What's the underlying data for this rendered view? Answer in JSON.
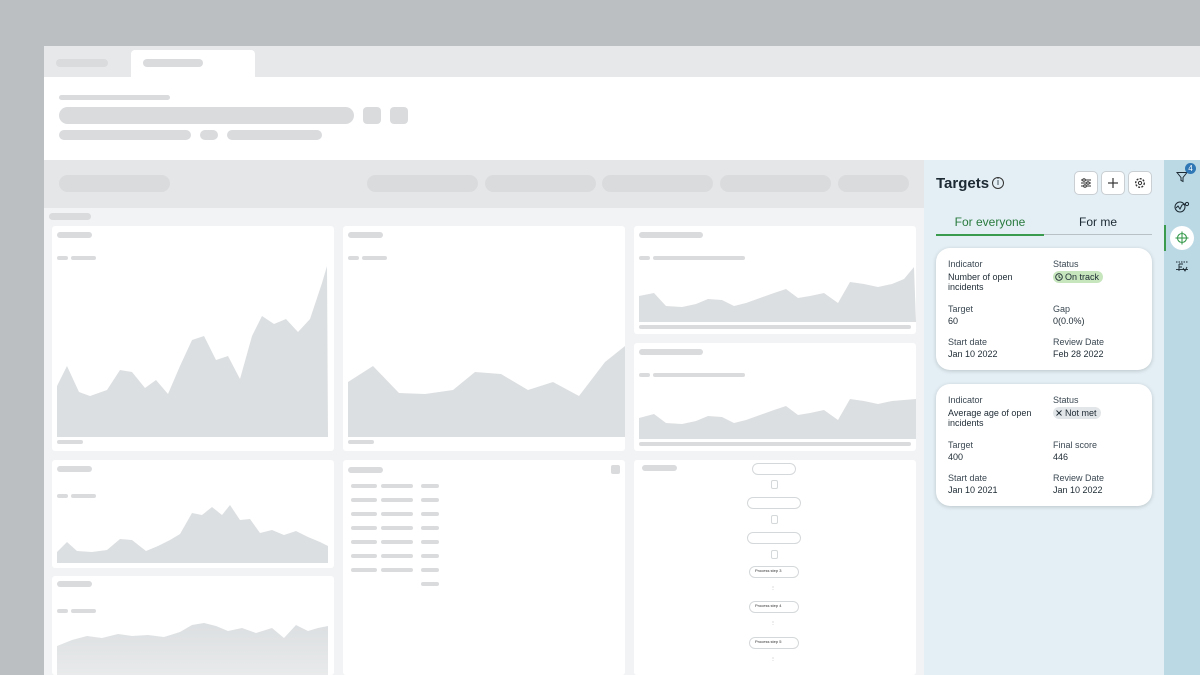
{
  "targets_panel": {
    "title": "Targets",
    "tabs": [
      {
        "label": "For everyone",
        "active": true
      },
      {
        "label": "For me",
        "active": false
      }
    ],
    "cards": [
      {
        "indicator_label": "Indicator",
        "indicator_value": "Number of open incidents",
        "status_label": "Status",
        "status_value": "On track",
        "target_label": "Target",
        "target_value": "60",
        "metric2_label": "Gap",
        "metric2_value": "0(0.0%)",
        "start_label": "Start date",
        "start_value": "Jan 10 2022",
        "review_label": "Review Date",
        "review_value": "Feb 28 2022"
      },
      {
        "indicator_label": "Indicator",
        "indicator_value": "Average age of open incidents",
        "status_label": "Status",
        "status_value": "Not met",
        "target_label": "Target",
        "target_value": "400",
        "metric2_label": "Final score",
        "metric2_value": "446",
        "start_label": "Start date",
        "start_value": "Jan 10 2021",
        "review_label": "Review Date",
        "review_value": "Jan 10 2022"
      }
    ]
  },
  "rail": {
    "filter_badge_count": "4",
    "icons": [
      "filter-icon",
      "analytics-icon",
      "target-icon",
      "formula-icon"
    ]
  },
  "flow": {
    "steps": [
      "Process step 3",
      "Process step 4",
      "Process step 5"
    ]
  },
  "colors": {
    "on_track": "#c7e6be",
    "not_met": "#e3e6e8",
    "accent_green": "#3a9b4e",
    "rail": "#bad9e5",
    "badge": "#2f77b5"
  }
}
